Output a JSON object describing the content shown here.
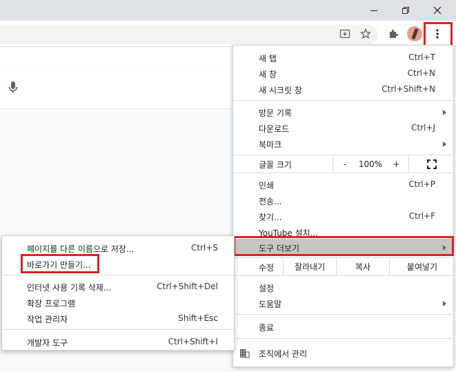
{
  "window": {
    "minimize_glyph": "—",
    "restore_glyph": "❐",
    "close_glyph": "✕"
  },
  "toolbar": {
    "icons": [
      "download-icon",
      "star-bookmark-icon",
      "extensions-puzzle-icon",
      "profile-avatar",
      "more-vert-icon"
    ]
  },
  "main_menu": {
    "new_tab": {
      "label": "새 탭",
      "shortcut": "Ctrl+T"
    },
    "new_window": {
      "label": "새 창",
      "shortcut": "Ctrl+N"
    },
    "new_incognito": {
      "label": "새 시크릿 창",
      "shortcut": "Ctrl+Shift+N"
    },
    "history": {
      "label": "방문 기록"
    },
    "downloads": {
      "label": "다운로드",
      "shortcut": "Ctrl+J"
    },
    "bookmarks": {
      "label": "북마크"
    },
    "zoom": {
      "label": "글꼴 크기",
      "minus": "-",
      "value": "100%",
      "plus": "+"
    },
    "print": {
      "label": "인쇄",
      "shortcut": "Ctrl+P"
    },
    "cast": {
      "label": "전송..."
    },
    "find": {
      "label": "찾기...",
      "shortcut": "Ctrl+F"
    },
    "youtube_install": {
      "label": "YouTube 설치..."
    },
    "more_tools": {
      "label": "도구 더보기"
    },
    "edit": {
      "label": "수정",
      "cut": "잘라내기",
      "copy": "복사",
      "paste": "붙여넣기"
    },
    "settings": {
      "label": "설정"
    },
    "help": {
      "label": "도움말"
    },
    "exit": {
      "label": "종료"
    },
    "managed": {
      "label": "조직에서 관리"
    }
  },
  "submenu": {
    "save_page": {
      "label": "페이지를 다른 이름으로 저장...",
      "shortcut": "Ctrl+S"
    },
    "create_shortcut": {
      "label": "바로가기 만들기..."
    },
    "clear_data": {
      "label": "인터넷 사용 기록 삭제...",
      "shortcut": "Ctrl+Shift+Del"
    },
    "extensions": {
      "label": "확장 프로그램"
    },
    "task_manager": {
      "label": "작업 관리자",
      "shortcut": "Shift+Esc"
    },
    "dev_tools": {
      "label": "개발자 도구",
      "shortcut": "Ctrl+Shift+I"
    }
  },
  "colors": {
    "highlight_box": "#e02020",
    "hover_row": "#c6c6c6",
    "titlebar": "#dee1e6"
  }
}
